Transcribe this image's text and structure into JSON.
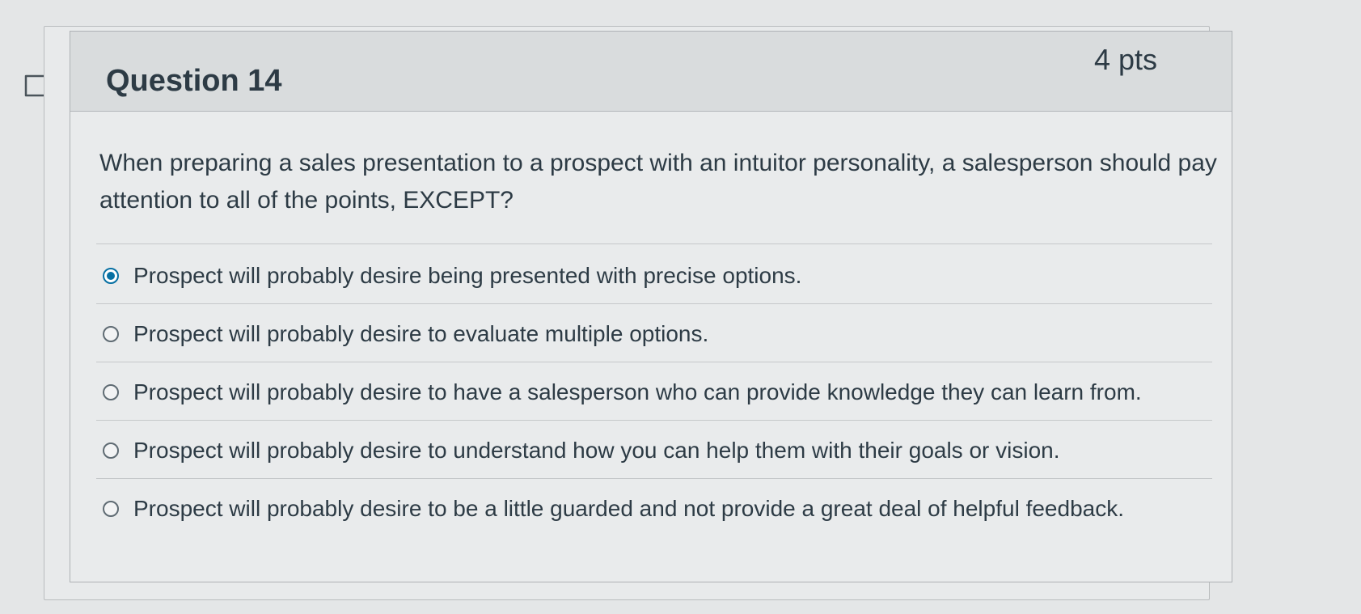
{
  "question": {
    "title": "Question 14",
    "points": "4 pts",
    "text": "When preparing a sales presentation to a prospect with an intuitor personality, a salesperson should pay attention to all of the points, EXCEPT?"
  },
  "answers": [
    {
      "label": "Prospect will probably desire being presented with precise options.",
      "selected": true
    },
    {
      "label": "Prospect will probably desire to evaluate multiple options.",
      "selected": false
    },
    {
      "label": "Prospect will probably desire to have a salesperson who can provide knowledge they can learn from.",
      "selected": false
    },
    {
      "label": "Prospect will probably desire to understand how you can help them with their goals or vision.",
      "selected": false
    },
    {
      "label": "Prospect will probably desire to be a little guarded and not provide a great deal of helpful feedback.",
      "selected": false
    }
  ],
  "colors": {
    "accent": "#0770a3",
    "text": "#2d3b45",
    "header_bg": "#d9dcdd"
  },
  "icons": {
    "flag": "flag-question-icon"
  }
}
